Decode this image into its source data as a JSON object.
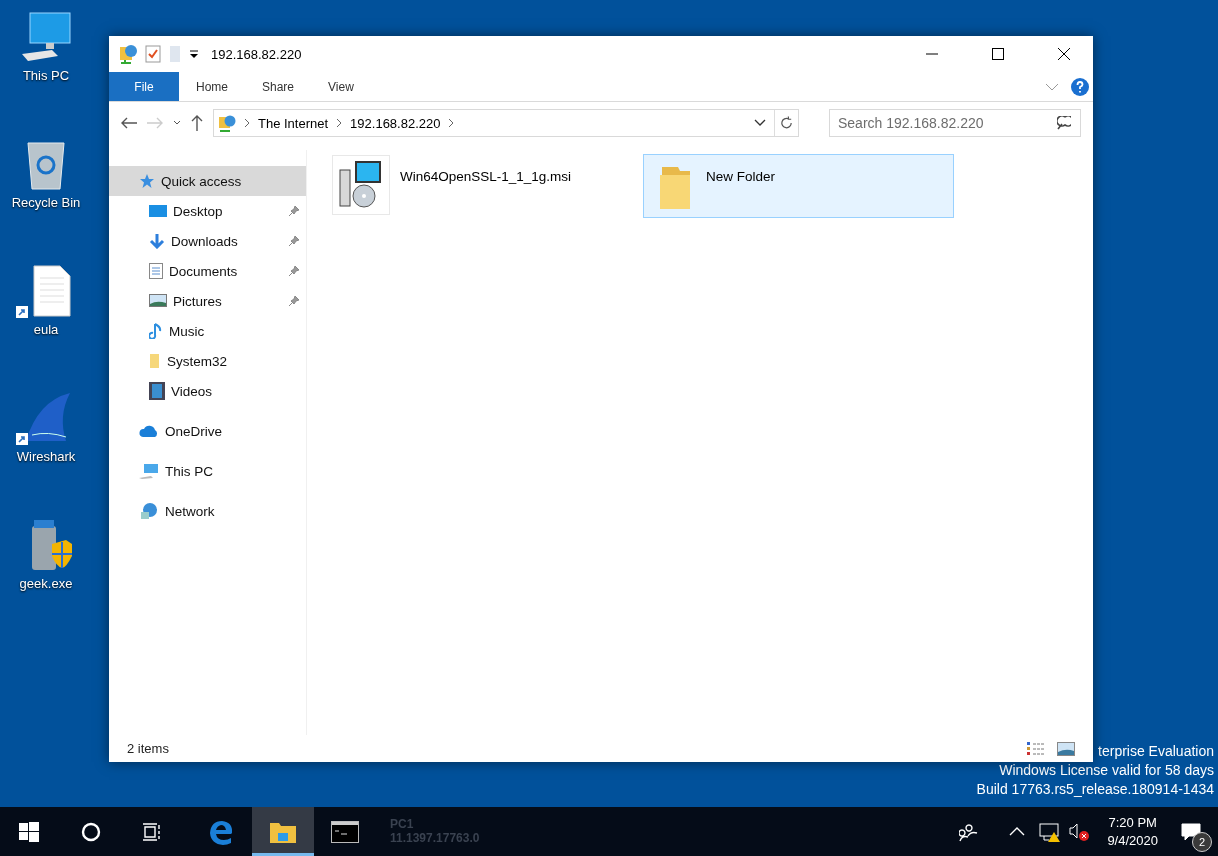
{
  "desktop_icons": [
    {
      "label": "This PC",
      "kind": "pc",
      "shortcut": false
    },
    {
      "label": "Recycle Bin",
      "kind": "bin",
      "shortcut": false
    },
    {
      "label": "eula",
      "kind": "doc",
      "shortcut": true
    },
    {
      "label": "Wireshark",
      "kind": "fin",
      "shortcut": true
    },
    {
      "label": "geek.exe",
      "kind": "geek",
      "shortcut": false
    }
  ],
  "window": {
    "title": "192.168.82.220",
    "ribbon_tabs": [
      {
        "label": "File",
        "kind": "file",
        "selected": false
      },
      {
        "label": "Home",
        "kind": "tab",
        "selected": false
      },
      {
        "label": "Share",
        "kind": "tab",
        "selected": false
      },
      {
        "label": "View",
        "kind": "tab",
        "selected": false
      }
    ],
    "address": {
      "crumbs": [
        "The Internet",
        "192.168.82.220"
      ]
    },
    "search": {
      "placeholder": "Search 192.168.82.220"
    },
    "nav": [
      {
        "label": "Quick access",
        "kind": "star",
        "selected": true,
        "children": [
          {
            "label": "Desktop",
            "kind": "desktop",
            "selected": false,
            "pinned": true
          },
          {
            "label": "Downloads",
            "kind": "download",
            "selected": false,
            "pinned": true
          },
          {
            "label": "Documents",
            "kind": "documents",
            "selected": false,
            "pinned": true
          },
          {
            "label": "Pictures",
            "kind": "pictures",
            "selected": false,
            "pinned": true
          },
          {
            "label": "Music",
            "kind": "music",
            "selected": false,
            "pinned": false
          },
          {
            "label": "System32",
            "kind": "folder",
            "selected": false,
            "pinned": false
          },
          {
            "label": "Videos",
            "kind": "videos",
            "selected": false,
            "pinned": false
          }
        ]
      },
      {
        "label": "OneDrive",
        "kind": "cloud",
        "selected": false
      },
      {
        "label": "This PC",
        "kind": "pc",
        "selected": false
      },
      {
        "label": "Network",
        "kind": "network",
        "selected": false
      }
    ],
    "files": [
      {
        "name": "Win64OpenSSL-1_1_1g.msi",
        "kind": "installer",
        "selected": false
      },
      {
        "name": "New Folder",
        "kind": "folder",
        "selected": true
      }
    ],
    "status_bar": {
      "count": "2 items"
    }
  },
  "watermark": [
    "terprise Evaluation",
    "Windows License valid for 58 days",
    "Build 17763.rs5_release.180914-1434"
  ],
  "taskbar": {
    "apps": [
      {
        "kind": "edge",
        "active": false
      },
      {
        "kind": "explorer",
        "active": true
      },
      {
        "kind": "cmd",
        "active": false
      }
    ],
    "background_text": [
      "PC1",
      "11.1397.17763.0"
    ],
    "clock": {
      "time": "7:20 PM",
      "date": "9/4/2020"
    },
    "notifications": "2"
  }
}
